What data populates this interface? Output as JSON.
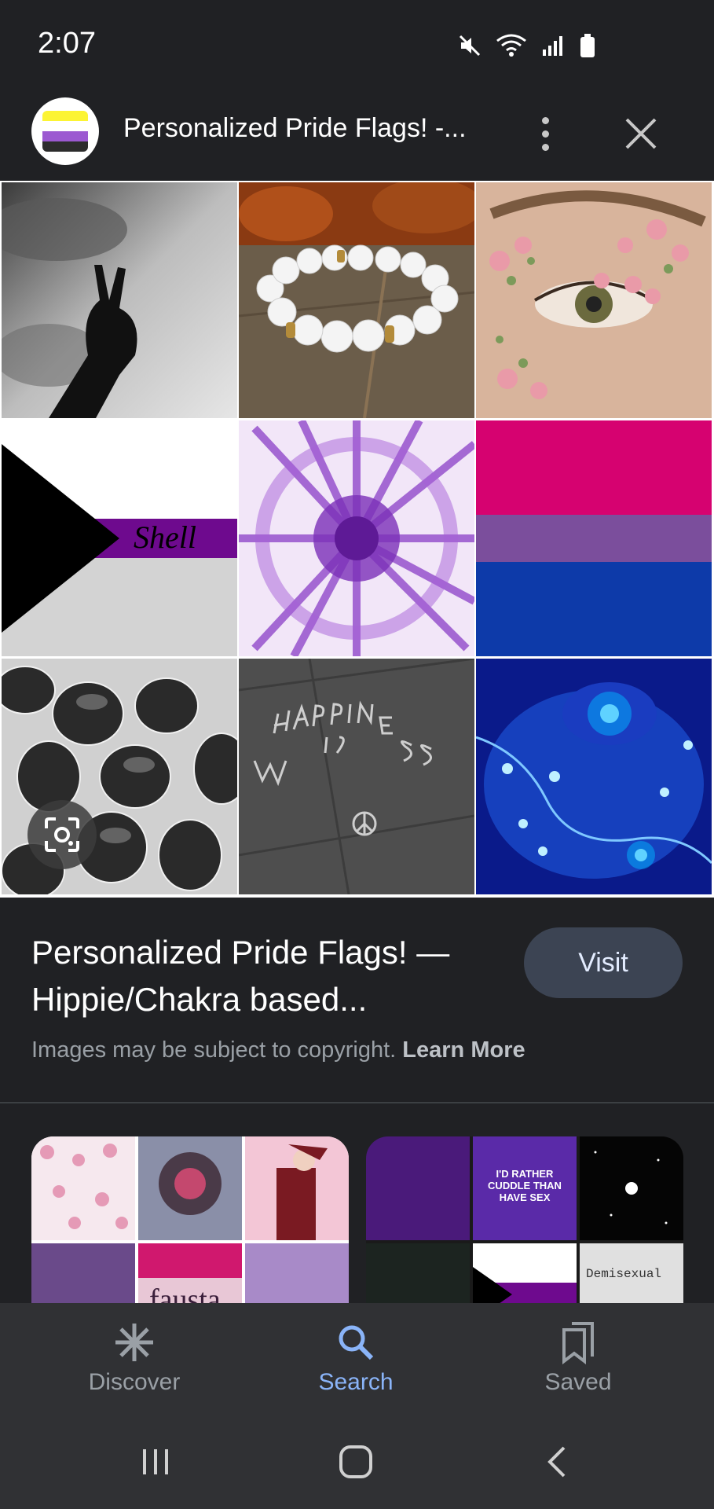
{
  "status_bar": {
    "time": "2:07",
    "icons": [
      "mute-icon",
      "wifi-icon",
      "signal-icon",
      "battery-icon"
    ]
  },
  "header": {
    "title": "Personalized Pride Flags! -...",
    "avatar_icon": "nonbinary-flag-avatar",
    "more_icon": "more-vert-icon",
    "close_icon": "close-icon"
  },
  "image_grid": {
    "tiles": [
      {
        "name": "peace-sign-hand"
      },
      {
        "name": "white-bead-bracelet"
      },
      {
        "name": "floral-eye-makeup"
      },
      {
        "name": "demisexual-flag",
        "text": "Shell"
      },
      {
        "name": "purple-tie-dye"
      },
      {
        "name": "bisexual-flag"
      },
      {
        "name": "gray-stones"
      },
      {
        "name": "chalk-happiness-sidewalk"
      },
      {
        "name": "blue-fairy-lights"
      }
    ],
    "lens_icon": "lens-icon"
  },
  "result": {
    "title": "Personalized Pride Flags! — Hippie/Chakra based...",
    "visit_label": "Visit",
    "copyright_text": "Images may be subject to copyright. ",
    "learn_more_label": "Learn More"
  },
  "related": {
    "cards": [
      {
        "name": "related-card-pink-aesthetic",
        "text": "fausta"
      },
      {
        "name": "related-card-purple-aesthetic",
        "quote": "I'D RATHER CUDDLE THAN HAVE SEX",
        "text": "Demisexual"
      }
    ]
  },
  "bottom_nav": {
    "items": [
      {
        "label": "Discover",
        "icon": "asterisk-icon",
        "active": false
      },
      {
        "label": "Search",
        "icon": "search-icon",
        "active": true
      },
      {
        "label": "Saved",
        "icon": "bookmarks-icon",
        "active": false
      }
    ]
  },
  "system_nav": {
    "icons": [
      "recents-icon",
      "home-icon",
      "back-icon"
    ]
  },
  "colors": {
    "background": "#202124",
    "nav_background": "#303134",
    "accent": "#8ab4f8",
    "visit_button": "#3c4453",
    "bisexual_pink": "#d60270",
    "bisexual_purple": "#7b4e9c",
    "bisexual_blue": "#0d3aa9",
    "demisexual_purple": "#6e0a8e"
  }
}
